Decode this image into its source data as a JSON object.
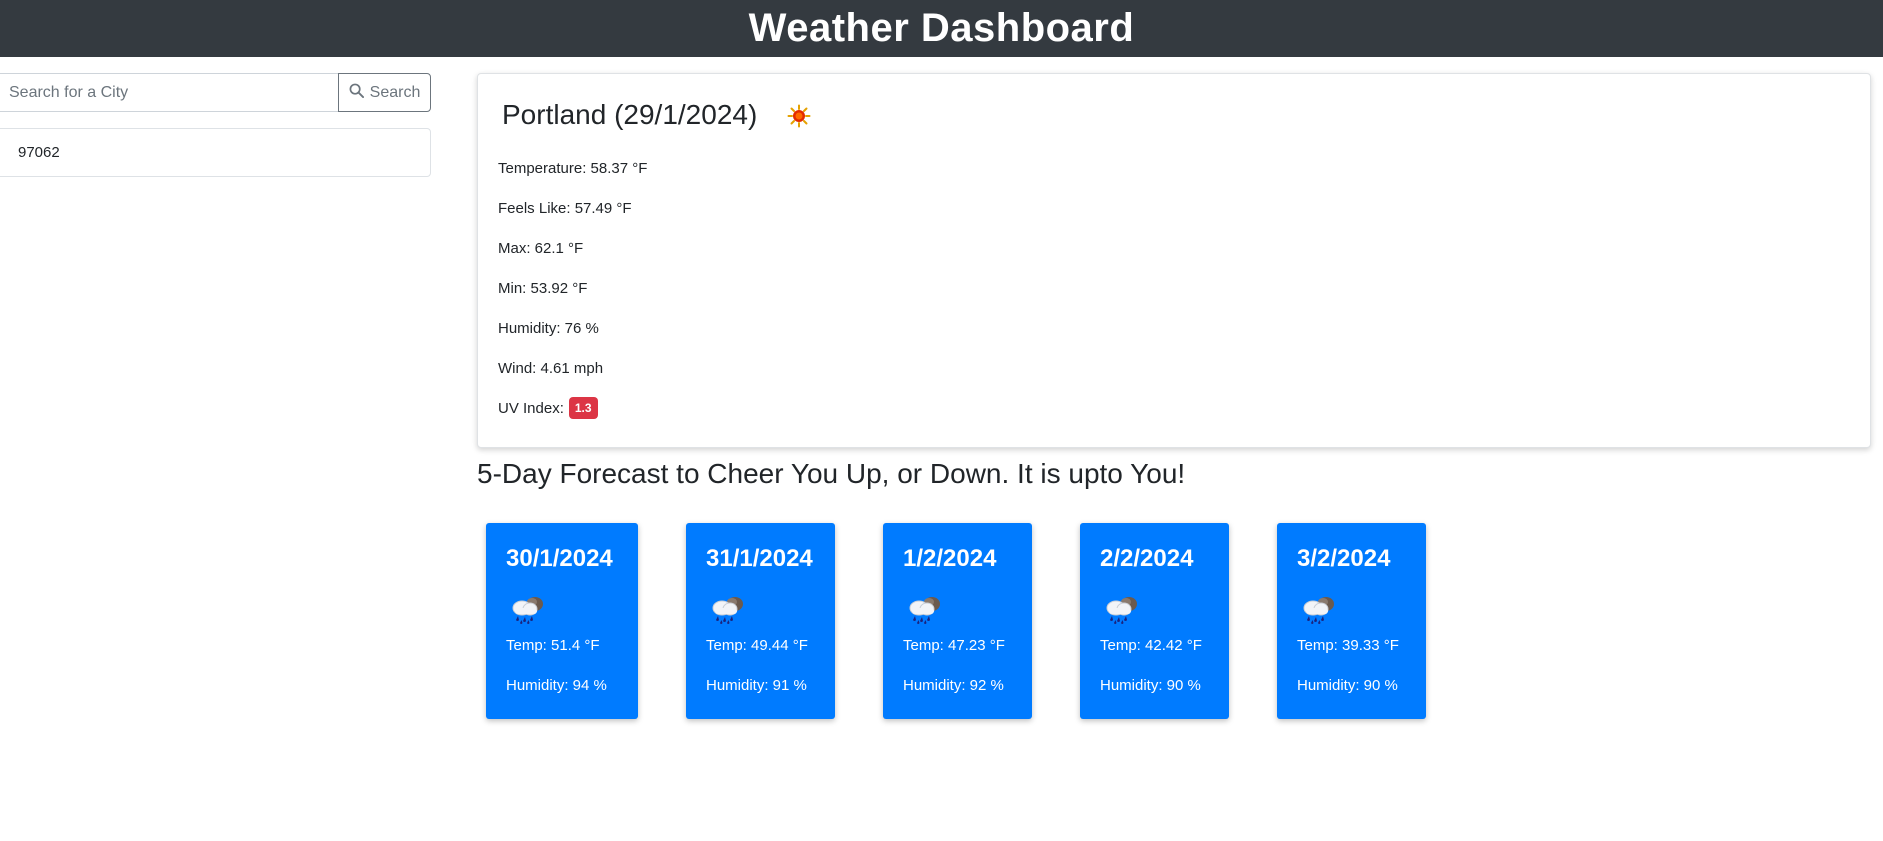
{
  "header": {
    "title": "Weather Dashboard"
  },
  "search": {
    "placeholder": "Search for a City",
    "button_label": "Search"
  },
  "history": [
    "97062"
  ],
  "current": {
    "title": "Portland (29/1/2024)",
    "icon": "sun-icon",
    "temperature": "Temperature: 58.37 °F",
    "feels_like": "Feels Like: 57.49 °F",
    "max": "Max: 62.1 °F",
    "min": "Min: 53.92 °F",
    "humidity": "Humidity: 76 %",
    "wind": "Wind: 4.61 mph",
    "uv_label": "UV Index:",
    "uv_value": "1.3",
    "uv_color": "#dc3545"
  },
  "forecast": {
    "title": "5-Day Forecast to Cheer You Up, or Down. It is upto You!",
    "days": [
      {
        "date": "30/1/2024",
        "icon": "rain-cloud-icon",
        "temp": "Temp: 51.4 °F",
        "humidity": "Humidity: 94 %"
      },
      {
        "date": "31/1/2024",
        "icon": "rain-cloud-icon",
        "temp": "Temp: 49.44 °F",
        "humidity": "Humidity: 91 %"
      },
      {
        "date": "1/2/2024",
        "icon": "rain-cloud-icon",
        "temp": "Temp: 47.23 °F",
        "humidity": "Humidity: 92 %"
      },
      {
        "date": "2/2/2024",
        "icon": "rain-cloud-icon",
        "temp": "Temp: 42.42 °F",
        "humidity": "Humidity: 90 %"
      },
      {
        "date": "3/2/2024",
        "icon": "rain-cloud-icon",
        "temp": "Temp: 39.33 °F",
        "humidity": "Humidity: 90 %"
      }
    ],
    "card_color": "#007bff"
  }
}
